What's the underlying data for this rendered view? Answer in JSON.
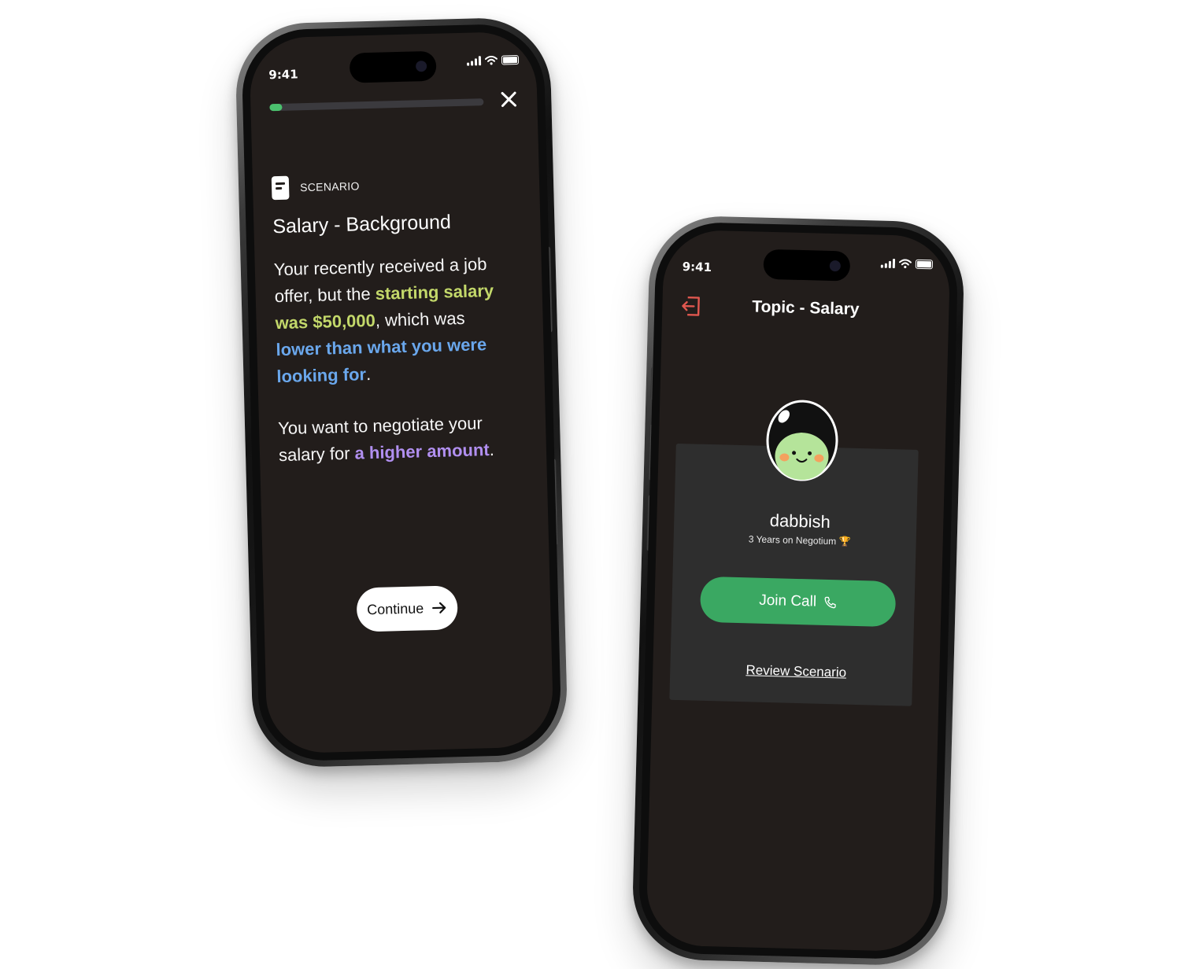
{
  "left_phone": {
    "status": {
      "time": "9:41"
    },
    "progress": {
      "fraction": 0.06,
      "fill_color": "#4bc16e"
    },
    "scenario": {
      "label": "SCENARIO",
      "title": "Salary - Background",
      "paragraph1": {
        "part1": "Your recently received a job offer, but the ",
        "highlight1": "starting salary was $50,000",
        "part2": ", which was ",
        "highlight2": "lower than what you were looking for",
        "part3": "."
      },
      "paragraph2": {
        "part1": "You want to negotiate your salary for ",
        "highlight1": "a higher amount",
        "part2": "."
      }
    },
    "continue_label": "Continue"
  },
  "right_phone": {
    "status": {
      "time": "9:41"
    },
    "topic_title": "Topic - Salary",
    "user": {
      "name": "dabbish",
      "meta": "3 Years on Negotium 🏆"
    },
    "join_call_label": "Join Call",
    "review_label": "Review Scenario"
  },
  "colors": {
    "screen_bg": "#221d1b",
    "card_bg": "#2e2e2e",
    "accent_green": "#3aa862",
    "highlight_green": "#c3d86a",
    "highlight_blue": "#6aa7ec",
    "highlight_purple": "#b18ff0",
    "exit_icon": "#e0574f"
  }
}
